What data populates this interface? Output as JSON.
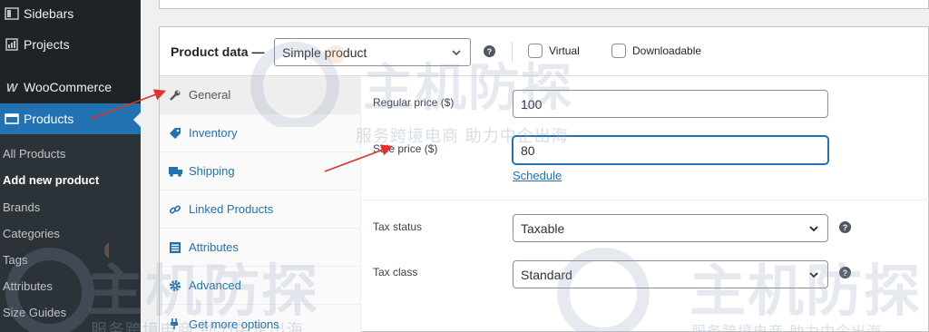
{
  "sidebar": {
    "items": [
      {
        "label": "Sidebars",
        "icon": "sidebars-icon"
      },
      {
        "label": "Projects",
        "icon": "projects-icon"
      },
      {
        "label": "WooCommerce",
        "icon": "woocommerce-icon"
      },
      {
        "label": "Products",
        "icon": "products-icon",
        "active": true
      }
    ],
    "submenu": [
      "All Products",
      "Add new product",
      "Brands",
      "Categories",
      "Tags",
      "Attributes",
      "Size Guides"
    ],
    "current_submenu": "Add new product"
  },
  "product_data": {
    "title": "Product data —",
    "product_type": "Simple product",
    "virtual_label": "Virtual",
    "downloadable_label": "Downloadable",
    "help_glyph": "?"
  },
  "tabs": [
    {
      "label": "General",
      "icon": "wrench-icon",
      "active": true
    },
    {
      "label": "Inventory",
      "icon": "tag-icon"
    },
    {
      "label": "Shipping",
      "icon": "truck-icon"
    },
    {
      "label": "Linked Products",
      "icon": "link-icon"
    },
    {
      "label": "Attributes",
      "icon": "list-icon"
    },
    {
      "label": "Advanced",
      "icon": "gear-icon"
    },
    {
      "label": "Get more options",
      "icon": "plugin-icon"
    }
  ],
  "general": {
    "regular_price_label": "Regular price ($)",
    "regular_price_value": "100",
    "sale_price_label": "Sale price ($)",
    "sale_price_value": "80",
    "schedule_link": "Schedule",
    "tax_status_label": "Tax status",
    "tax_status_value": "Taxable",
    "tax_class_label": "Tax class",
    "tax_class_value": "Standard"
  },
  "watermark": {
    "logo_text": "主机防探",
    "tagline": "服务跨境电商 助力中企出海",
    "tagline_partial": "服务跨境电商 助力中企出海"
  },
  "colors": {
    "sidebar_bg": "#1d2327",
    "submenu_bg": "#2c3338",
    "accent": "#2271b1",
    "arrow": "#e0332c"
  }
}
